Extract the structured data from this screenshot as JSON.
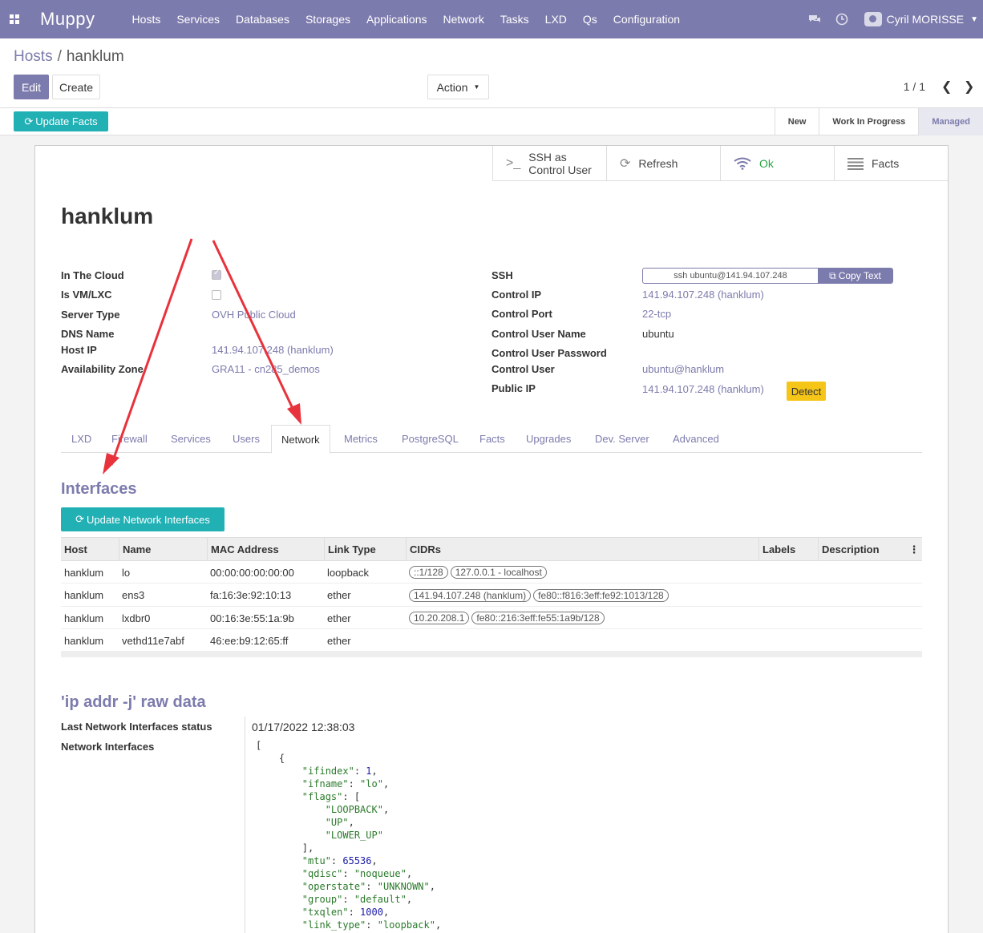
{
  "topbar": {
    "brand": "Muppy",
    "menu": [
      "Hosts",
      "Services",
      "Databases",
      "Storages",
      "Applications",
      "Network",
      "Tasks",
      "LXD",
      "Qs",
      "Configuration"
    ],
    "user": "Cyril MORISSE"
  },
  "breadcrumb": {
    "parent": "Hosts",
    "current": "hanklum"
  },
  "controls": {
    "edit": "Edit",
    "create": "Create",
    "action": "Action",
    "pager": "1 / 1"
  },
  "statusbar": {
    "update_facts": "Update Facts",
    "stages": [
      "New",
      "Work In Progress",
      "Managed"
    ],
    "active_stage": "Managed"
  },
  "buttonbox": {
    "ssh": "SSH as\nControl User",
    "ssh_line1": "SSH as",
    "ssh_line2": "Control User",
    "refresh": "Refresh",
    "status": "Ok",
    "facts": "Facts"
  },
  "record": {
    "name": "hanklum",
    "left_fields": {
      "in_the_cloud": {
        "label": "In The Cloud",
        "checked": true
      },
      "is_vm": {
        "label": "Is VM/LXC",
        "checked": false
      },
      "server_type": {
        "label": "Server Type",
        "value": "OVH Public Cloud"
      },
      "dns_name": {
        "label": "DNS Name",
        "value": ""
      },
      "host_ip": {
        "label": "Host IP",
        "value": "141.94.107.248 (hanklum)"
      },
      "availability_zone": {
        "label": "Availability Zone",
        "value": "GRA11 - cn285_demos"
      }
    },
    "right_fields": {
      "ssh": {
        "label": "SSH",
        "value": "ssh ubuntu@141.94.107.248",
        "copy": "Copy Text"
      },
      "control_ip": {
        "label": "Control IP",
        "value": "141.94.107.248 (hanklum)"
      },
      "control_port": {
        "label": "Control Port",
        "value": "22-tcp"
      },
      "control_user_name": {
        "label": "Control User Name",
        "value": "ubuntu"
      },
      "control_user_password": {
        "label": "Control User Password",
        "value": ""
      },
      "control_user": {
        "label": "Control User",
        "value": "ubuntu@hanklum"
      },
      "public_ip": {
        "label": "Public IP",
        "value": "141.94.107.248 (hanklum)",
        "detect": "Detect"
      }
    }
  },
  "tabs": [
    "LXD",
    "Firewall",
    "Services",
    "Users",
    "Network",
    "Metrics",
    "PostgreSQL",
    "Facts",
    "Upgrades",
    "Dev. Server",
    "Advanced"
  ],
  "active_tab": "Network",
  "interfaces": {
    "heading": "Interfaces",
    "update_button": "Update Network Interfaces",
    "columns": [
      "Host",
      "Name",
      "MAC Address",
      "Link Type",
      "CIDRs",
      "Labels",
      "Description"
    ],
    "rows": [
      {
        "host": "hanklum",
        "name": "lo",
        "mac": "00:00:00:00:00:00",
        "link": "loopback",
        "cidrs": [
          "::1/128",
          "127.0.0.1 - localhost"
        ]
      },
      {
        "host": "hanklum",
        "name": "ens3",
        "mac": "fa:16:3e:92:10:13",
        "link": "ether",
        "cidrs": [
          "141.94.107.248 (hanklum)",
          "fe80::f816:3eff:fe92:1013/128"
        ]
      },
      {
        "host": "hanklum",
        "name": "lxdbr0",
        "mac": "00:16:3e:55:1a:9b",
        "link": "ether",
        "cidrs": [
          "10.20.208.1",
          "fe80::216:3eff:fe55:1a9b/128"
        ]
      },
      {
        "host": "hanklum",
        "name": "vethd11e7abf",
        "mac": "46:ee:b9:12:65:ff",
        "link": "ether",
        "cidrs": []
      }
    ]
  },
  "raw": {
    "heading": "'ip addr -j' raw data",
    "last_status_label": "Last Network Interfaces status",
    "last_status_value": "01/17/2022 12:38:03",
    "interfaces_label": "Network Interfaces"
  },
  "colors": {
    "brand": "#7c7bad",
    "teal": "#21b0b4",
    "warning": "#f5c518",
    "arrow": "#e8323c"
  }
}
